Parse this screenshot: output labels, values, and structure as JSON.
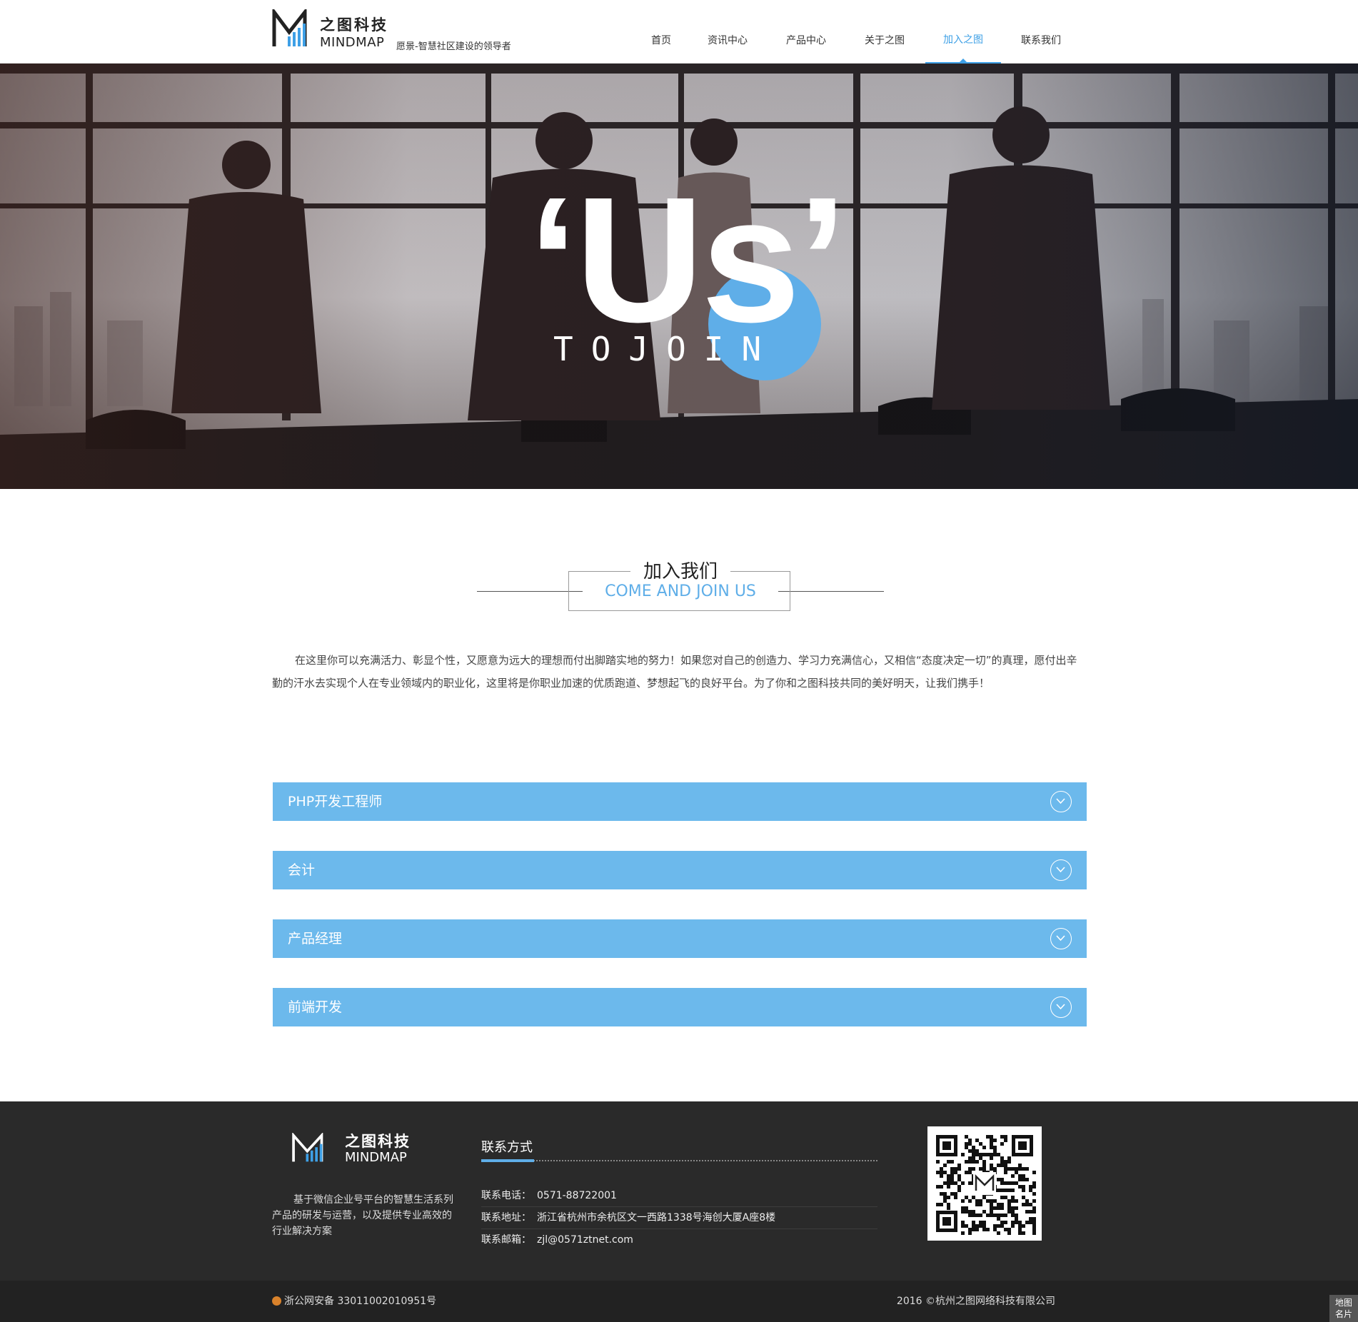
{
  "brand": {
    "name_cn": "之图科技",
    "name_en": "MINDMAP",
    "slogan": "愿景-智慧社区建设的领导者"
  },
  "nav": [
    {
      "label": "首页",
      "active": false
    },
    {
      "label": "资讯中心",
      "active": false
    },
    {
      "label": "产品中心",
      "active": false
    },
    {
      "label": "关于之图",
      "active": false
    },
    {
      "label": "加入之图",
      "active": true
    },
    {
      "label": "联系我们",
      "active": false
    }
  ],
  "hero": {
    "headline": "‘Us’",
    "sub": "TOJOIN",
    "accent_color": "#5faee8"
  },
  "section": {
    "title_cn": "加入我们",
    "title_en": "COME AND JOIN US",
    "intro": "在这里你可以充满活力、彰显个性，又愿意为远大的理想而付出脚踏实地的努力！如果您对自己的创造力、学习力充满信心，又相信“态度决定一切”的真理，愿付出辛勤的汗水去实现个人在专业领域内的职业化，这里将是你职业加速的优质跑道、梦想起飞的良好平台。为了你和之图科技共同的美好明天，让我们携手！"
  },
  "jobs": [
    {
      "title": "PHP开发工程师",
      "icon": "chevron-down-circle-icon"
    },
    {
      "title": "会计",
      "icon": "chevron-down-circle-icon"
    },
    {
      "title": "产品经理",
      "icon": "chevron-down-circle-icon"
    },
    {
      "title": "前端开发",
      "icon": "chevron-down-circle-icon"
    }
  ],
  "footer": {
    "name_cn": "之图科技",
    "name_en": "MINDMAP",
    "description": "基于微信企业号平台的智慧生活系列产品的研发与运营，以及提供专业高效的行业解决方案",
    "contact_title": "联系方式",
    "contacts": [
      {
        "label": "联系电话：",
        "value": "0571-88722001"
      },
      {
        "label": "联系地址：",
        "value": "浙江省杭州市余杭区文一西路1338号海创大厦A座8楼"
      },
      {
        "label": "联系邮箱：",
        "value": "zjl@0571ztnet.com"
      }
    ],
    "icp": "浙公网安备 33011002010951号",
    "copyright": "2016 ©杭州之图网络科技有限公司",
    "badge": [
      "地图",
      "名片"
    ]
  },
  "colors": {
    "accent": "#5faee8",
    "accordion": "#6cb9ec",
    "footer_bg": "#2a2a2a"
  }
}
